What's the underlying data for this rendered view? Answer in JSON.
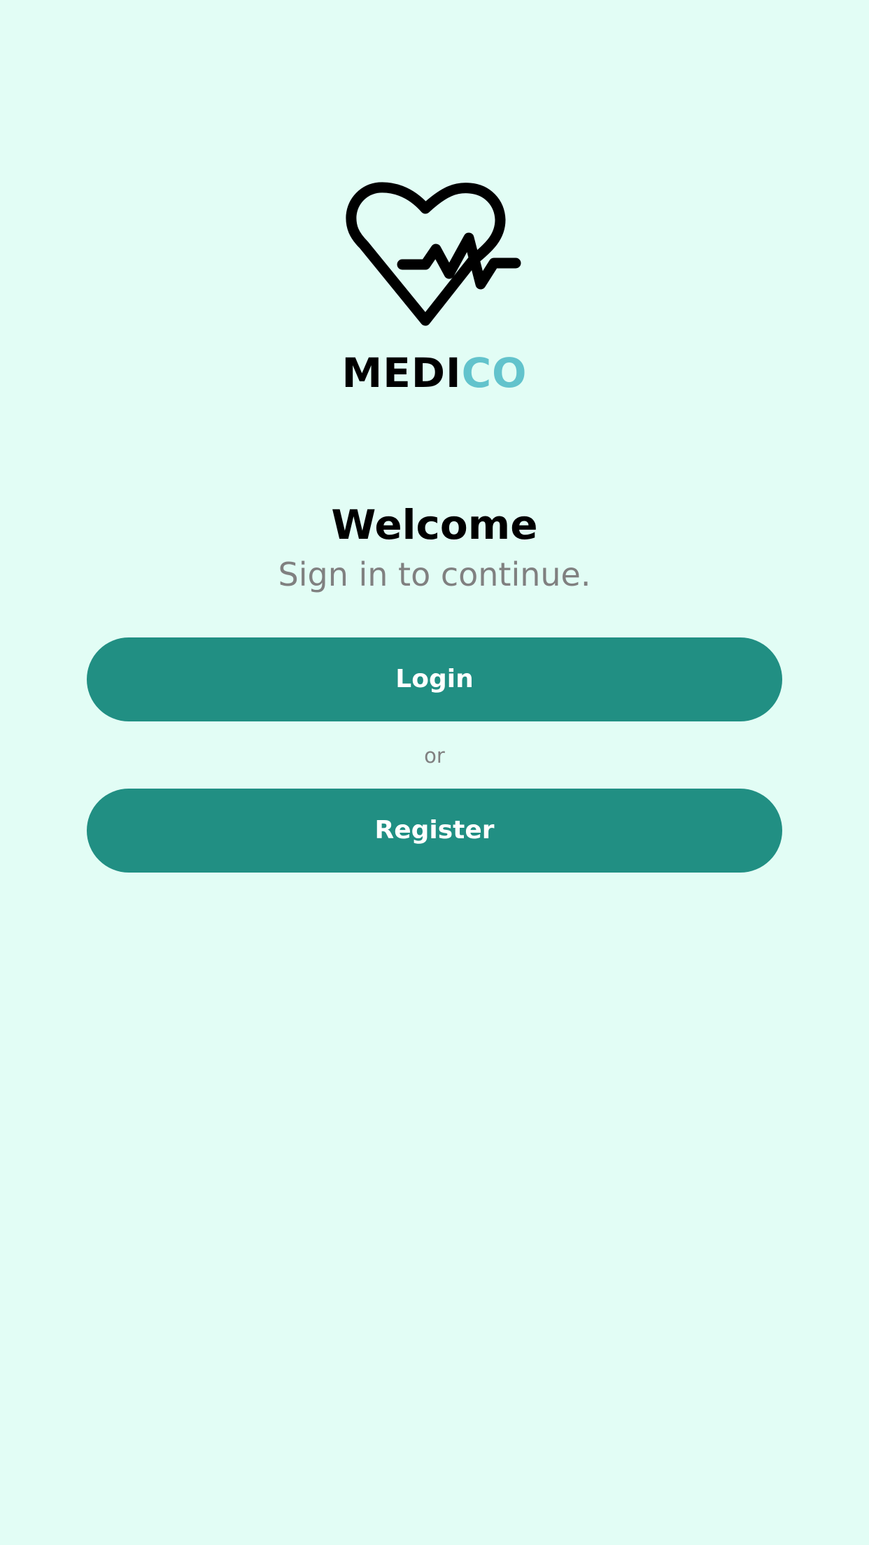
{
  "brand": {
    "logo_icon": "heart-pulse-icon",
    "name_part1": "MEDI",
    "name_part2": "CO",
    "color_primary": "#000000",
    "color_accent": "#62c3cc"
  },
  "welcome": {
    "title": "Welcome",
    "subtitle": "Sign in to continue."
  },
  "actions": {
    "login_label": "Login",
    "separator": "or",
    "register_label": "Register",
    "button_color": "#218f83"
  },
  "theme": {
    "background": "#e2fdf5"
  }
}
